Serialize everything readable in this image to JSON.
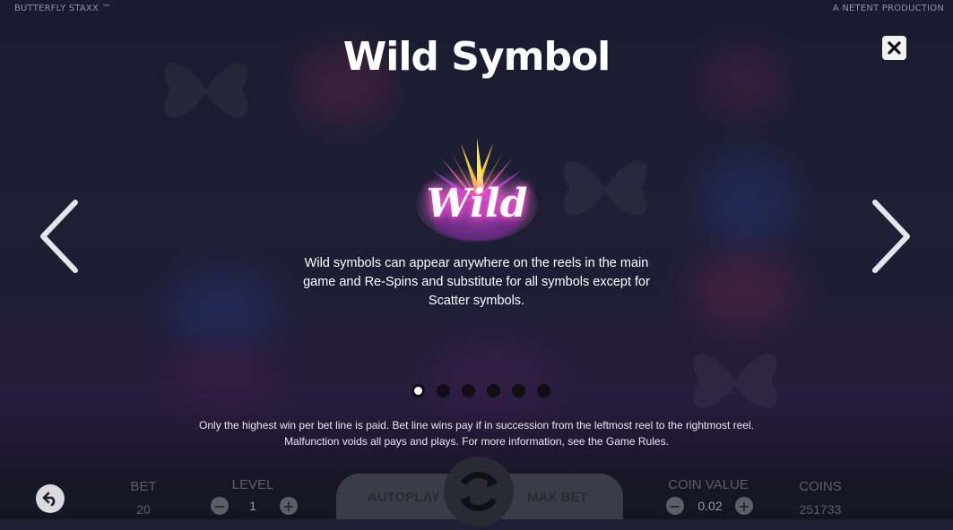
{
  "header": {
    "game_title": "BUTTERFLY STAXX ™",
    "producer": "A NETENT PRODUCTION"
  },
  "page": {
    "title": "Wild Symbol",
    "symbol_label": "Wild",
    "description": "Wild symbols can appear anywhere on the reels in the main game and Re-Spins and substitute for all symbols except for Scatter symbols.",
    "page_count": 6,
    "active_page": 1
  },
  "legal": {
    "line1": "Only the highest win per bet line is paid. Bet line wins pay if in succession from the leftmost reel to the rightmost reel.",
    "line2": "Malfunction voids all pays and plays. For more information, see the Game Rules."
  },
  "controls": {
    "bet_label": "BET",
    "bet_value": "20",
    "level_label": "LEVEL",
    "level_value": "1",
    "autoplay_label": "AUTOPLAY",
    "maxbet_label": "MAX BET",
    "coin_value_label": "COIN VALUE",
    "coin_value": "0.02",
    "coins_label": "COINS",
    "coins_value": "251733"
  },
  "icons": [
    "close-icon",
    "arrow-left-icon",
    "arrow-right-icon",
    "back-icon",
    "spin-icon",
    "minus-icon",
    "plus-icon"
  ],
  "colors": {
    "background": "#262843",
    "text": "#ffffff",
    "dot_active": "#ffffff",
    "dot_inactive": "#0e0e14"
  }
}
